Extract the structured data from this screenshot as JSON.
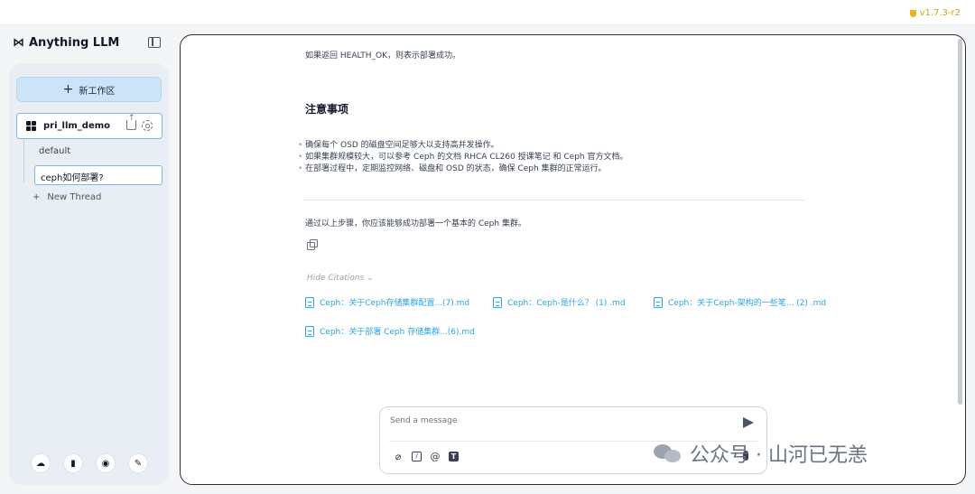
{
  "app": {
    "brand_logo": "⋈",
    "brand_name": "Anything LLM",
    "version": "v1.7.3-r2"
  },
  "sidebar": {
    "new_workspace_label": "新工作区",
    "workspace": {
      "name": "pri_llm_demo"
    },
    "threads": [
      {
        "label": "default"
      },
      {
        "label": "ceph如何部署?"
      }
    ],
    "new_thread_label": "New Thread"
  },
  "message": {
    "p1": "如果返回 HEALTH_OK，则表示部署成功。",
    "heading": "注意事项",
    "bullets": [
      "确保每个 OSD 的磁盘空间足够大以支持高并发操作。",
      "如果集群规模较大，可以参考 Ceph 的文档 RHCA CL260 授课笔记 和 Ceph 官方文档。",
      "在部署过程中，定期监控网络、磁盘和 OSD 的状态，确保 Ceph 集群的正常运行。"
    ],
    "p2": "通过以上步骤，你应该能够成功部署一个基本的 Ceph 集群。",
    "hide_citations": "Hide Citations ⌄",
    "citations": [
      "Ceph：关于Ceph存储集群配置...(7).md",
      "Ceph：Ceph-是什么？ (1) .md",
      "Ceph：关于Ceph-架构的一些笔... (2) .md",
      "Ceph：关于部署 Ceph 存储集群...(6).md"
    ]
  },
  "composer": {
    "placeholder": "Send a message"
  },
  "watermark": "公众号 · 山河已无恙"
}
